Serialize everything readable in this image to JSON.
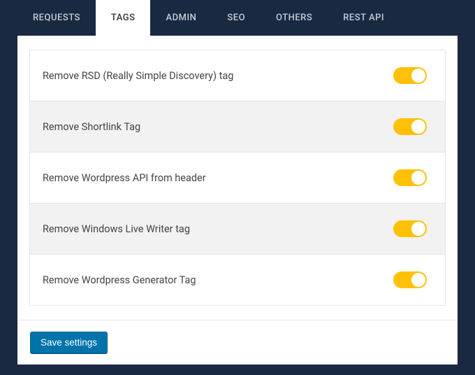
{
  "tabs": [
    {
      "label": "REQUESTS",
      "active": false
    },
    {
      "label": "TAGS",
      "active": true
    },
    {
      "label": "ADMIN",
      "active": false
    },
    {
      "label": "SEO",
      "active": false
    },
    {
      "label": "OTHERS",
      "active": false
    },
    {
      "label": "REST API",
      "active": false
    }
  ],
  "settings": [
    {
      "label": "Remove RSD (Really Simple Discovery) tag",
      "enabled": true
    },
    {
      "label": "Remove Shortlink Tag",
      "enabled": true
    },
    {
      "label": "Remove Wordpress API from header",
      "enabled": true
    },
    {
      "label": "Remove Windows Live Writer tag",
      "enabled": true
    },
    {
      "label": "Remove Wordpress Generator Tag",
      "enabled": true
    }
  ],
  "footer": {
    "save_label": "Save settings"
  }
}
